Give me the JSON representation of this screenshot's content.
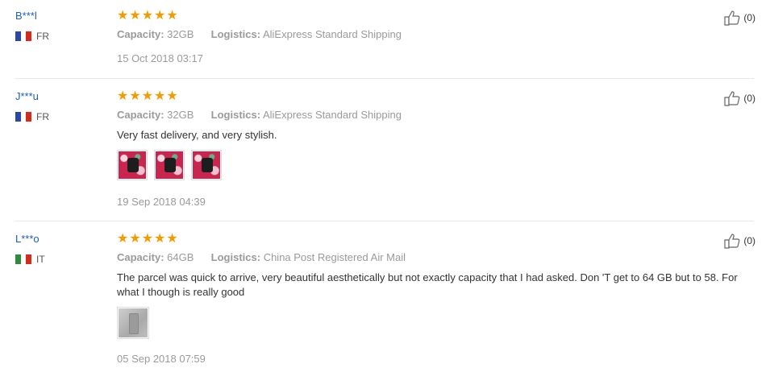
{
  "reviews": [
    {
      "user": "B***l",
      "country": "FR",
      "flag_colors": [
        "#2a48a8",
        "#ffffff",
        "#d52b1e"
      ],
      "stars": 5,
      "capacity_label": "Capacity:",
      "capacity": "32GB",
      "logistics_label": "Logistics:",
      "logistics": "AliExpress Standard Shipping",
      "text": "",
      "photos": [],
      "date": "15 Oct 2018 03:17",
      "likes": "(0)"
    },
    {
      "user": "J***u",
      "country": "FR",
      "flag_colors": [
        "#2a48a8",
        "#ffffff",
        "#d52b1e"
      ],
      "stars": 5,
      "capacity_label": "Capacity:",
      "capacity": "32GB",
      "logistics_label": "Logistics:",
      "logistics": "AliExpress Standard Shipping",
      "text": "Very fast delivery, and very stylish.",
      "photos": [
        "red-photo",
        "red-photo",
        "red-photo"
      ],
      "date": "19 Sep 2018 04:39",
      "likes": "(0)"
    },
    {
      "user": "L***o",
      "country": "IT",
      "flag_colors": [
        "#2e8b3c",
        "#ffffff",
        "#d52b1e"
      ],
      "stars": 5,
      "capacity_label": "Capacity:",
      "capacity": "64GB",
      "logistics_label": "Logistics:",
      "logistics": "China Post Registered Air Mail",
      "text": "The parcel was quick to arrive, very beautiful aesthetically but not exactly capacity that I had asked. Don 'T get to 64 GB but to 58. For what I though is really good",
      "photos": [
        "grey-photo"
      ],
      "date": "05 Sep 2018 07:59",
      "likes": "(0)"
    }
  ],
  "colors": {
    "star": "#f59a00",
    "user_link": "#1a5fb4",
    "meta": "#9a9a9a"
  }
}
